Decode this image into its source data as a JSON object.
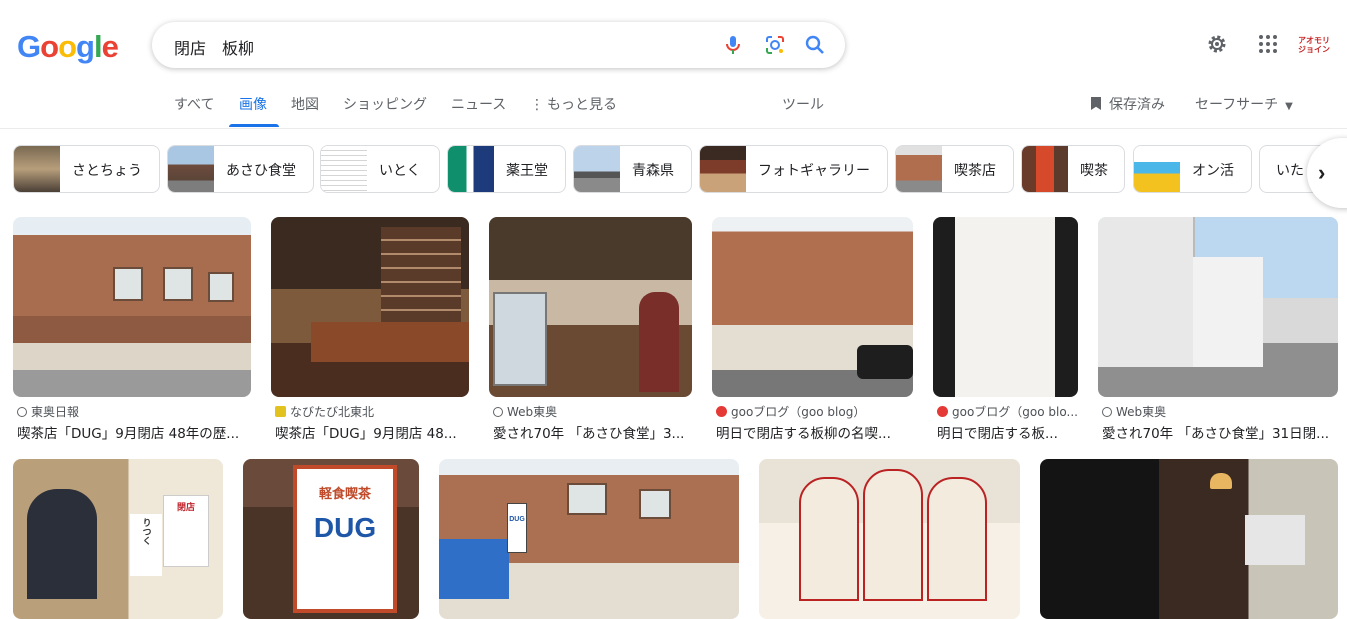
{
  "search": {
    "query": "閉店　板柳"
  },
  "tabs": [
    {
      "label": "すべて"
    },
    {
      "label": "画像"
    },
    {
      "label": "地図"
    },
    {
      "label": "ショッピング"
    },
    {
      "label": "ニュース"
    },
    {
      "label": "もっと見る"
    }
  ],
  "tools": {
    "label": "ツール"
  },
  "saved": {
    "label": "保存済み"
  },
  "safesearch": {
    "label": "セーフサーチ"
  },
  "account": {
    "label": "アオモリジョイン"
  },
  "chips": [
    {
      "label": "さとちょう"
    },
    {
      "label": "あさひ食堂"
    },
    {
      "label": "いとく"
    },
    {
      "label": "薬王堂"
    },
    {
      "label": "青森県"
    },
    {
      "label": "フォトギャラリー"
    },
    {
      "label": "喫茶店"
    },
    {
      "label": "喫茶"
    },
    {
      "label": "オン活"
    },
    {
      "label": "いた"
    }
  ],
  "results": [
    {
      "source": "東奥日報",
      "title": "喫茶店「DUG」9月閉店 48年の歴..."
    },
    {
      "source": "なびたび北東北",
      "title": "喫茶店「DUG」9月閉店 48..."
    },
    {
      "source": "Web東奥",
      "title": "愛され70年 「あさひ食堂」3..."
    },
    {
      "source": "gooブログ（goo blog）",
      "title": "明日で閉店する板柳の名喫..."
    },
    {
      "source": "gooブログ（goo blo...",
      "title": "明日で閉店する板..."
    },
    {
      "source": "Web東奥",
      "title": "愛され70年 「あさひ食堂」31日閉..."
    }
  ],
  "row2": [
    {
      "signs": [
        "閉店",
        "りつく"
      ]
    },
    {
      "signs": [
        "軽食喫茶",
        "DUG"
      ]
    },
    {
      "signs": [
        "DUG"
      ]
    },
    {
      "signs": []
    },
    {
      "signs": []
    }
  ],
  "colors": {
    "accent": "#1a73e8",
    "brand_blue": "#4285f4",
    "brand_red": "#ea4335",
    "brand_yellow": "#fbbc05",
    "brand_green": "#34a853"
  }
}
